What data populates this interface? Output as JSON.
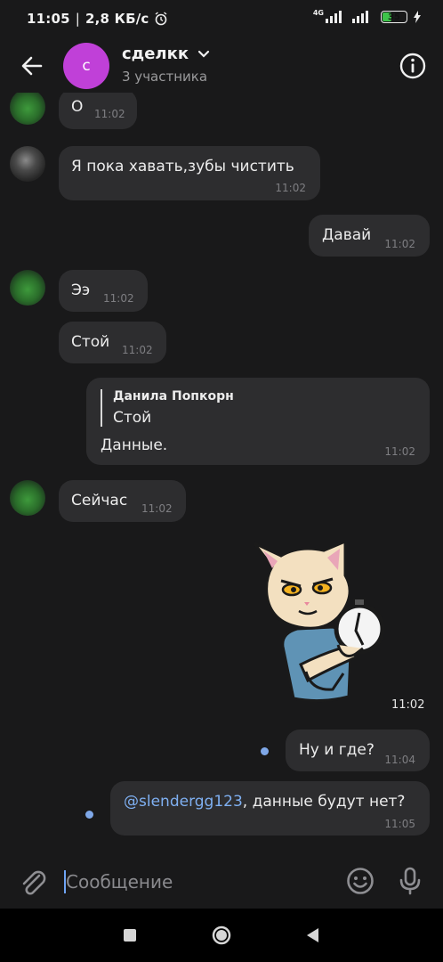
{
  "status_bar": {
    "time": "11:05",
    "speed": "2,8 КБ/с",
    "network_type": "4G",
    "battery": "35"
  },
  "header": {
    "avatar_letter": "с",
    "title": "сделкк",
    "subtitle": "3 участника"
  },
  "messages": [
    {
      "text": "О",
      "time": "11:02"
    },
    {
      "text": "Я пока хавать,зубы чистить",
      "time": "11:02"
    },
    {
      "text": "Давай",
      "time": "11:02"
    },
    {
      "text": "Ээ",
      "time": "11:02"
    },
    {
      "text": "Стой",
      "time": "11:02"
    },
    {
      "reply_author": "Данила Попкорн",
      "reply_text": "Стой",
      "text": "Данные.",
      "time": "11:02"
    },
    {
      "text": "Сейчас",
      "time": "11:02"
    },
    {
      "sticker": "cat-with-stopwatch-sticker",
      "time": "11:02"
    },
    {
      "text": "Ну и где?",
      "time": "11:04"
    },
    {
      "mention": "@slendergg123",
      "text": ", данные будут нет?",
      "time": "11:05"
    }
  ],
  "composer": {
    "placeholder": "Сообщение"
  },
  "colors": {
    "background": "#19191a",
    "bubble": "#2d2d2f",
    "avatar": "#c040d8",
    "mention": "#7fb0f2",
    "unread_dot": "#7fa8e8"
  }
}
